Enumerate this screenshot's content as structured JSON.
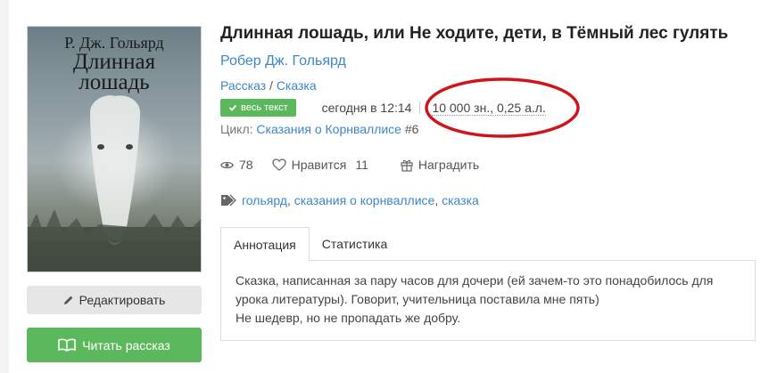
{
  "cover": {
    "author_text": "Р. Дж. Гольярд",
    "title_line1": "Длинная",
    "title_line2": "лошадь"
  },
  "buttons": {
    "edit_label": "Редактировать",
    "read_label": "Читать рассказ",
    "edit_icon": "pencil-icon",
    "read_icon": "open-book-icon"
  },
  "book": {
    "title": "Длинная лошадь, или Не ходите, дети, в Тёмный лес гулять",
    "author": "Робер Дж. Гольярд",
    "genre1": "Рассказ",
    "genre_sep": " / ",
    "genre2": "Сказка",
    "status_badge": "весь текст",
    "updated": "сегодня в 12:14",
    "size": "10 000 зн., 0,25 а.л.",
    "cycle_label": "Цикл:",
    "cycle_name": "Сказания о Корнваллисе",
    "cycle_number": "#6"
  },
  "stats": {
    "views": "78",
    "likes_label": "Нравится",
    "likes_count": "11",
    "reward_label": "Наградить"
  },
  "tags": {
    "icon": "tag-icon",
    "tag1": "гольярд",
    "tag2": "сказания о корнваллисе",
    "tag3": "сказка",
    "sep": ", "
  },
  "tabs": {
    "annotation": "Аннотация",
    "statistics": "Статистика"
  },
  "annotation": {
    "line1": "Сказка, написанная за пару часов для дочери (ей зачем-то это понадобилось для",
    "line2": "урока литературы). Говорит, учительница поставила мне пять)",
    "line3": "Не шедевр, но не пропадать же добру."
  },
  "colors": {
    "link": "#3d87c6",
    "success": "#5cb85c",
    "annotation_circle": "#d0141c"
  }
}
